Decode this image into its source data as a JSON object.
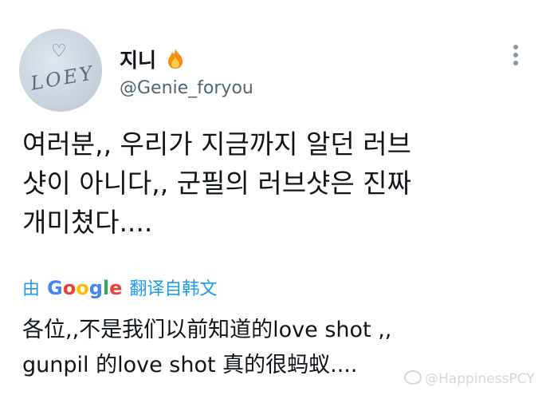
{
  "user": {
    "avatar_text": "LOEY",
    "avatar_heart": "♡",
    "display_name": "지니",
    "handle": "@Genie_foryou"
  },
  "tweet": {
    "text": "여러분,, 우리가 지금까지 알던 러브\n샷이 아니다,, 군필의 러브샷은 진짜\n개미쳤다...."
  },
  "translation": {
    "prefix": "由",
    "provider": "Google",
    "suffix": "翻译自韩文",
    "text": "各位,,不是我们以前知道的love shot ,,\ngunpil 的love shot 真的很蚂蚁...."
  },
  "watermark": {
    "text": "@HappinessPCY"
  },
  "icons": {
    "more": "more-vertical-icon",
    "fire": "fire-emoji-icon",
    "weibo": "weibo-logo-icon"
  },
  "colors": {
    "accent": "#1d9bf0",
    "secondary_text": "#536471"
  }
}
